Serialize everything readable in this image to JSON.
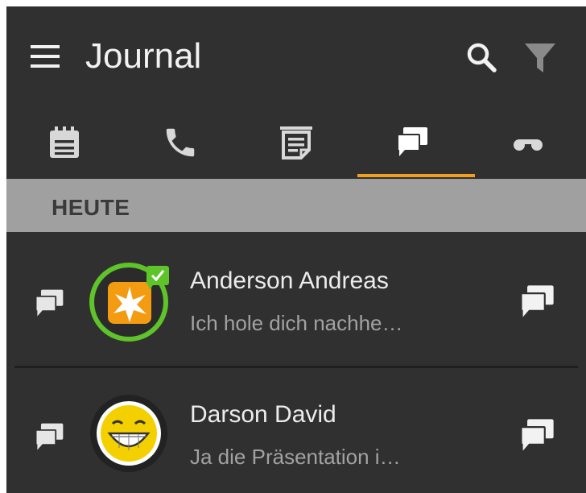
{
  "header": {
    "title": "Journal",
    "menu_icon": "hamburger-menu-icon",
    "search_icon": "search-icon",
    "filter_icon": "filter-icon"
  },
  "tabs": [
    {
      "icon": "calendar-icon",
      "selected": false
    },
    {
      "icon": "phone-icon",
      "selected": false
    },
    {
      "icon": "notes-icon",
      "selected": false
    },
    {
      "icon": "chat-icon",
      "selected": true
    },
    {
      "icon": "voicemail-icon",
      "selected": false
    }
  ],
  "section": {
    "label": "HEUTE"
  },
  "items": [
    {
      "name": "Anderson Andreas",
      "preview": "Ich hole dich nachhe…",
      "type_icon": "chat-icon",
      "action_icon": "chat-icon",
      "avatar": "star-avatar",
      "status": "online-verified-badge"
    },
    {
      "name": "Darson David",
      "preview": "Ja die Präsentation i…",
      "type_icon": "chat-icon",
      "action_icon": "chat-icon",
      "avatar": "smiley-avatar"
    }
  ],
  "colors": {
    "background": "#303030",
    "accent": "#f0a020",
    "section_bg": "#a0a0a0",
    "status_green": "#5fc32a"
  }
}
